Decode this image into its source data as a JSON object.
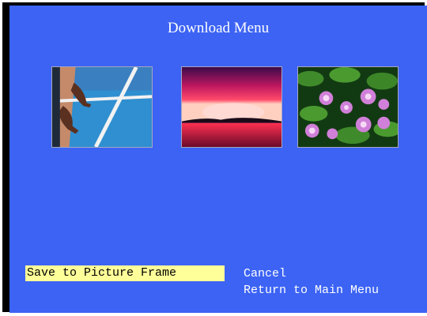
{
  "title": "Download Menu",
  "thumbnails": [
    {
      "subject": "hands on track starting line",
      "icon": "runner-photo"
    },
    {
      "subject": "sunset over water",
      "icon": "sunset-photo"
    },
    {
      "subject": "pink water lilies",
      "icon": "water-lily-photo"
    }
  ],
  "menu": {
    "save_label": "Save to Picture Frame",
    "cancel_label": "Cancel",
    "return_label": "Return to Main Menu"
  },
  "colors": {
    "background": "#3c63f4",
    "border": "#000000",
    "highlight": "#ffff99",
    "text": "#ffffff"
  }
}
